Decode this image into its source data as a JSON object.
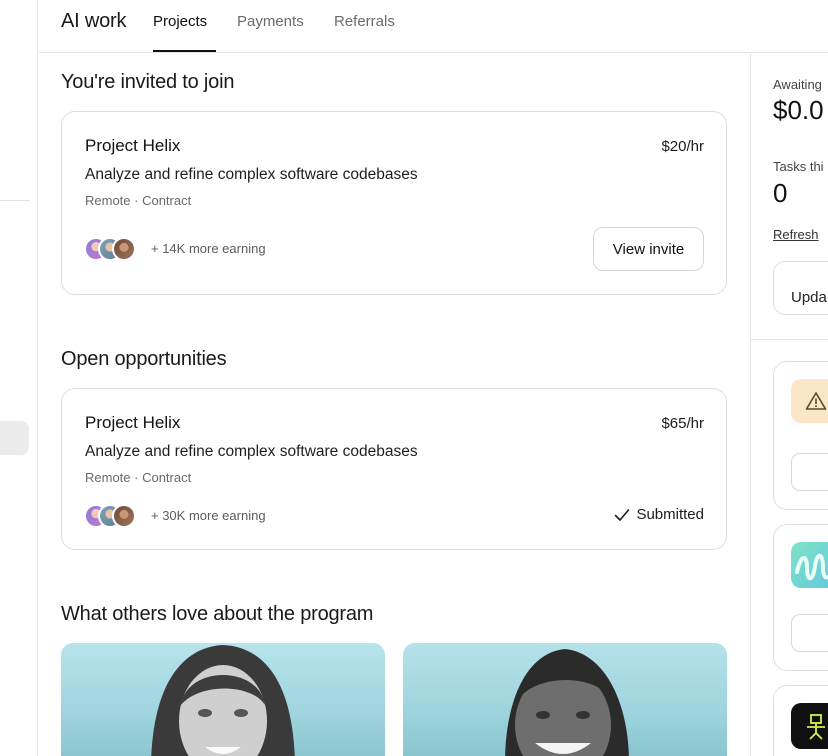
{
  "header": {
    "app_title": "AI work",
    "tabs": [
      {
        "label": "Projects",
        "active": true
      },
      {
        "label": "Payments",
        "active": false
      },
      {
        "label": "Referrals",
        "active": false
      }
    ]
  },
  "invited": {
    "section_title": "You're invited to join",
    "card": {
      "title": "Project Helix",
      "rate": "$20/hr",
      "description": "Analyze and refine complex software codebases",
      "meta": "Remote · Contract",
      "earning_text": "+ 14K more earning",
      "action_label": "View invite"
    }
  },
  "open": {
    "section_title": "Open opportunities",
    "card": {
      "title": "Project Helix",
      "rate": "$65/hr",
      "description": "Analyze and refine complex software codebases",
      "meta": "Remote · Contract",
      "earning_text": "+ 30K more earning",
      "status_label": "Submitted"
    }
  },
  "testimonials": {
    "section_title": "What others love about the program"
  },
  "right_panel": {
    "awaiting_label": "Awaiting",
    "awaiting_value": "$0.0",
    "tasks_label": "Tasks thi",
    "tasks_value": "0",
    "refresh_link": "Refresh",
    "update_button": "Upda"
  },
  "colors": {
    "warning_bg": "#fbe7c8",
    "testimonial_bg": "#a4d8e1",
    "border": "#dedede"
  },
  "icons": [
    "warning-icon",
    "checkmark-icon",
    "squiggle-logo-icon",
    "robot-icon"
  ]
}
